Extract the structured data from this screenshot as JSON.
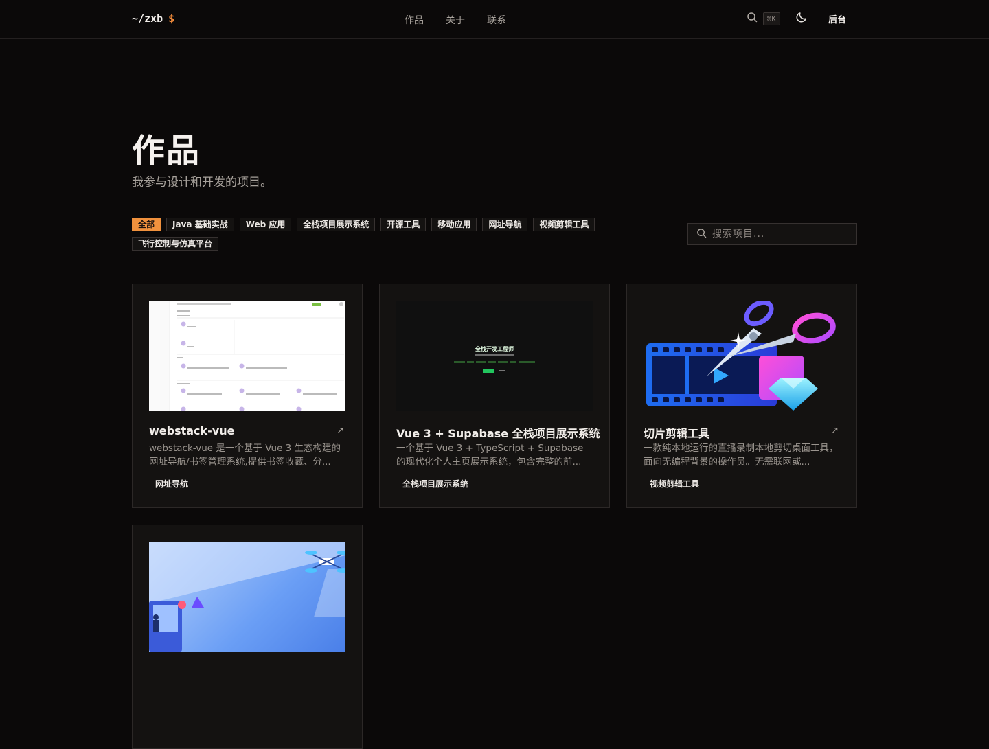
{
  "header": {
    "logo_text": "~/zxb",
    "logo_symbol": "$",
    "nav": [
      "作品",
      "关于",
      "联系"
    ],
    "shortcut": "⌘K",
    "admin_label": "后台"
  },
  "page": {
    "title": "作品",
    "subtitle": "我参与设计和开发的项目。"
  },
  "filters": [
    "全部",
    "Java 基础实战",
    "Web 应用",
    "全栈项目展示系统",
    "开源工具",
    "移动应用",
    "网址导航",
    "视频剪辑工具",
    "飞行控制与仿真平台"
  ],
  "active_filter": "全部",
  "search": {
    "placeholder": "搜索项目..."
  },
  "projects": [
    {
      "title": "webstack-vue",
      "description": "webstack-vue 是一个基于 Vue 3 生态构建的网址导航/书签管理系统,提供书签收藏、分...",
      "tag": "网址导航"
    },
    {
      "title": "Vue 3 + Supabase 全栈项目展示系统",
      "description": "一个基于 Vue 3 + TypeScript + Supabase 的现代化个人主页展示系统，包含完整的前...",
      "tag": "全栈项目展示系统",
      "thumb_heading": "全栈开发工程师"
    },
    {
      "title": "切片剪辑工具",
      "description": "一款纯本地运行的直播录制本地剪切桌面工具，面向无编程背景的操作员。无需联网或...",
      "tag": "视频剪辑工具"
    },
    {
      "title": "",
      "description": "",
      "tag": ""
    }
  ],
  "colors": {
    "accent": "#f0913d",
    "background": "#0b0909",
    "card": "#141211"
  }
}
